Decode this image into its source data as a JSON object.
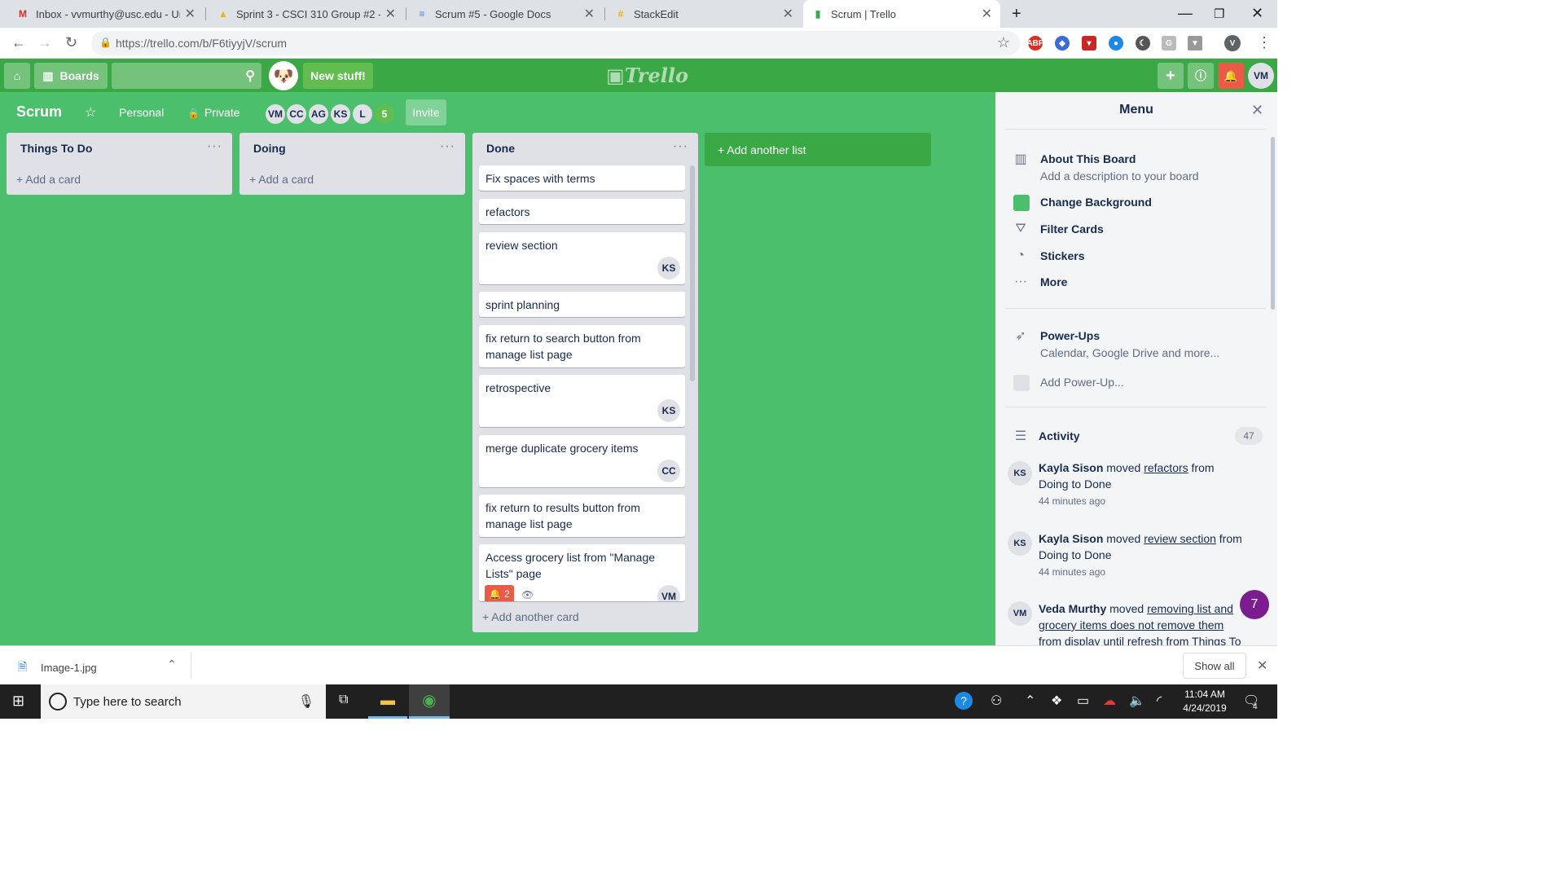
{
  "browser": {
    "tabs": [
      {
        "title": "Inbox - vvmurthy@usc.edu - Uni",
        "icon": "gmail-icon",
        "glyph": "M",
        "color": "#d93025"
      },
      {
        "title": "Sprint 3 - CSCI 310 Group #2 - G",
        "icon": "google-drive-icon",
        "glyph": "▲",
        "color": "#f4b400"
      },
      {
        "title": "Scrum #5 - Google Docs",
        "icon": "google-docs-icon",
        "glyph": "≡",
        "color": "#4285f4"
      },
      {
        "title": "StackEdit",
        "icon": "stackedit-icon",
        "glyph": "#",
        "color": "#f0b400"
      },
      {
        "title": "Scrum | Trello",
        "icon": "trello-icon",
        "glyph": "▮",
        "color": "#3aa844"
      }
    ],
    "url": "https://trello.com/b/F6tiyyjV/scrum",
    "profile_initial": "V"
  },
  "header": {
    "boards_label": "Boards",
    "new_stuff": "New stuff!",
    "logo": "Trello",
    "user_initials": "VM"
  },
  "board": {
    "name": "Scrum",
    "team": "Personal",
    "visibility": "Private",
    "members": [
      "VM",
      "CC",
      "AG",
      "KS",
      "L"
    ],
    "extra_members": "5",
    "invite": "Invite",
    "add_list": "+ Add another list",
    "lists": [
      {
        "title": "Things To Do",
        "add": "+ Add a card"
      },
      {
        "title": "Doing",
        "add": "+ Add a card"
      },
      {
        "title": "Done",
        "add": "+ Add another card",
        "cards": [
          {
            "text": "Fix spaces with terms",
            "member": ""
          },
          {
            "text": "refactors",
            "member": ""
          },
          {
            "text": "review section",
            "member": "KS"
          },
          {
            "text": "sprint planning",
            "member": ""
          },
          {
            "text": "fix return to search button from manage list page",
            "member": ""
          },
          {
            "text": "retrospective",
            "member": "KS"
          },
          {
            "text": "merge duplicate grocery items",
            "member": "CC"
          },
          {
            "text": "fix return to results button from manage list page",
            "member": ""
          },
          {
            "text": "Access grocery list from \"Manage Lists\" page",
            "member": "VM",
            "badge": "2"
          }
        ]
      }
    ]
  },
  "menu": {
    "title": "Menu",
    "about": "About This Board",
    "about_sub": "Add a description to your board",
    "change_bg": "Change Background",
    "filter": "Filter Cards",
    "stickers": "Stickers",
    "more": "More",
    "powerups": "Power-Ups",
    "powerups_sub": "Calendar, Google Drive and more...",
    "add_powerup": "Add Power-Up...",
    "activity": "Activity",
    "activity_count": "47",
    "bg_color": "#4bbf6b",
    "entries": [
      {
        "initials": "KS",
        "name": "Kayla Sison",
        "verb": "moved",
        "card": "refactors",
        "rest": "from Doing to Done",
        "time": "44 minutes ago"
      },
      {
        "initials": "KS",
        "name": "Kayla Sison",
        "verb": "moved",
        "card": "review section",
        "rest": "from Doing to Done",
        "time": "44 minutes ago"
      },
      {
        "initials": "VM",
        "name": "Veda Murthy",
        "verb": "moved",
        "card": "removing list and grocery items does not remove them from display until refresh",
        "rest": "from Things To",
        "time": ""
      }
    ],
    "chat_badge": "7"
  },
  "download": {
    "file": "Image-1.jpg",
    "show_all": "Show all"
  },
  "taskbar": {
    "search": "Type here to search",
    "time": "11:04 AM",
    "date": "4/24/2019",
    "notif": "4"
  }
}
